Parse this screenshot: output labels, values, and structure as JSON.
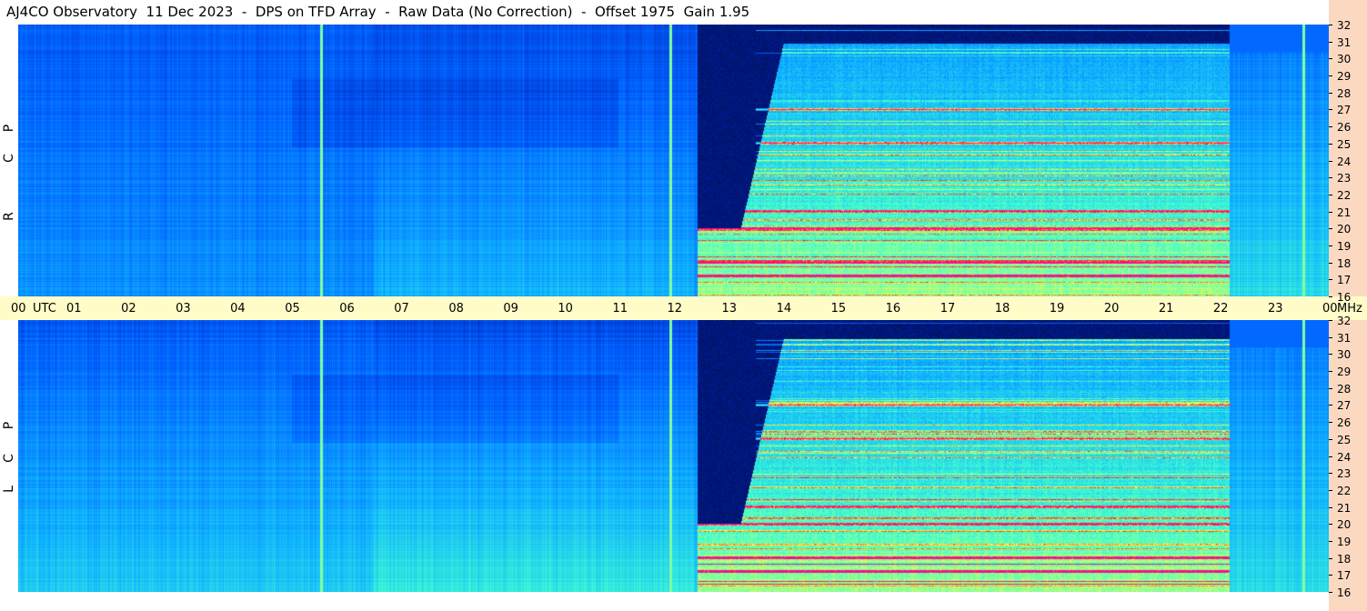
{
  "title": "AJ4CO Observatory  11 Dec 2023  -  DPS on TFD Array  -  Raw Data (No Correction)  -  Offset 1975  Gain 1.95",
  "colors": {
    "time_axis_bg": "#fffcc8",
    "freq_axis_bg": "#fbd9c0",
    "colormap": [
      "#000a28",
      "#0020b0",
      "#0060ff",
      "#10b4ff",
      "#40ffd0",
      "#ffff40",
      "#ff2020",
      "#ff00c0"
    ]
  },
  "chart_data": [
    {
      "type": "heatmap",
      "title": "",
      "panel_label": [
        "R",
        "C",
        "P"
      ],
      "xlabel": "UTC",
      "ylabel": "MHz",
      "x_ticks": [
        "00",
        "01",
        "02",
        "03",
        "04",
        "05",
        "06",
        "07",
        "08",
        "09",
        "10",
        "11",
        "12",
        "13",
        "14",
        "15",
        "16",
        "17",
        "18",
        "19",
        "20",
        "21",
        "22",
        "23",
        "00"
      ],
      "y_ticks": [
        "32",
        "31",
        "30",
        "29",
        "28",
        "27",
        "26",
        "25",
        "24",
        "23",
        "22",
        "21",
        "20",
        "19",
        "18",
        "17",
        "16"
      ],
      "xlim_hours": [
        0,
        24
      ],
      "ylim_mhz": [
        16,
        32
      ],
      "features": {
        "dark_block_hours": [
          12.45,
          22.2
        ],
        "vertical_lines_hours": [
          5.55,
          11.95,
          23.55
        ],
        "strong_bands_mhz": [
          27,
          25,
          21,
          20,
          18,
          17.2
        ]
      }
    },
    {
      "type": "heatmap",
      "title": "",
      "panel_label": [
        "L",
        "C",
        "P"
      ],
      "xlabel": "UTC",
      "ylabel": "MHz",
      "x_ticks": [
        "00",
        "01",
        "02",
        "03",
        "04",
        "05",
        "06",
        "07",
        "08",
        "09",
        "10",
        "11",
        "12",
        "13",
        "14",
        "15",
        "16",
        "17",
        "18",
        "19",
        "20",
        "21",
        "22",
        "23",
        "00"
      ],
      "y_ticks": [
        "32",
        "31",
        "30",
        "29",
        "28",
        "27",
        "26",
        "25",
        "24",
        "23",
        "22",
        "21",
        "20",
        "19",
        "18",
        "17",
        "16"
      ],
      "xlim_hours": [
        0,
        24
      ],
      "ylim_mhz": [
        16,
        32
      ],
      "features": {
        "dark_block_hours": [
          12.45,
          22.2
        ],
        "vertical_lines_hours": [
          5.55,
          11.95,
          23.55
        ],
        "strong_bands_mhz": [
          27,
          25,
          21,
          20,
          18,
          17.2
        ]
      }
    }
  ],
  "axis": {
    "utc_label": "UTC",
    "mhz_label": "MHz"
  }
}
